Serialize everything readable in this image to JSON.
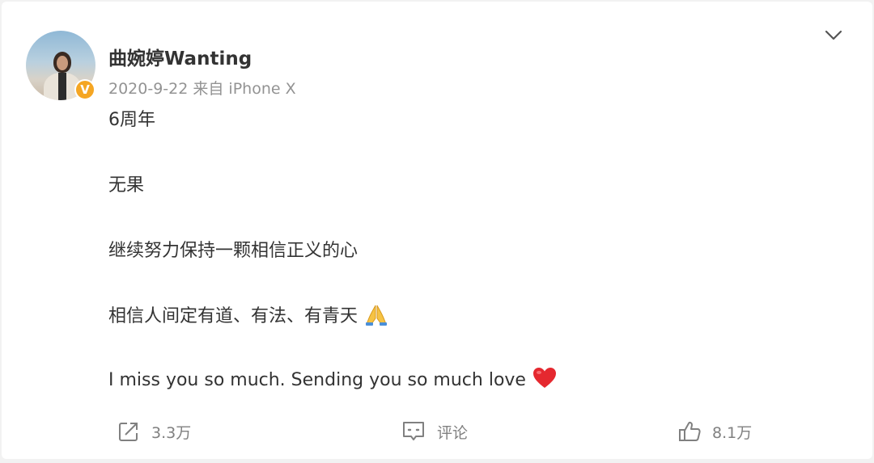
{
  "post": {
    "author": {
      "name": "曲婉婷Wanting",
      "avatar_badge": "V",
      "badge_color": "#f5a623"
    },
    "meta": "2020-9-22 来自 iPhone X",
    "content": [
      "6周年",
      "无果",
      "继续努力保持一颗相信正义的心",
      "相信人间定有道、有法、有青天",
      "I miss you so much. Sending you so much love"
    ],
    "emojis": [
      "folded-hands",
      "red-heart"
    ],
    "actions": {
      "repost_count": "3.3万",
      "comment_label": "评论",
      "like_count": "8.1万"
    },
    "menu_icon": "chevron-down-icon"
  }
}
